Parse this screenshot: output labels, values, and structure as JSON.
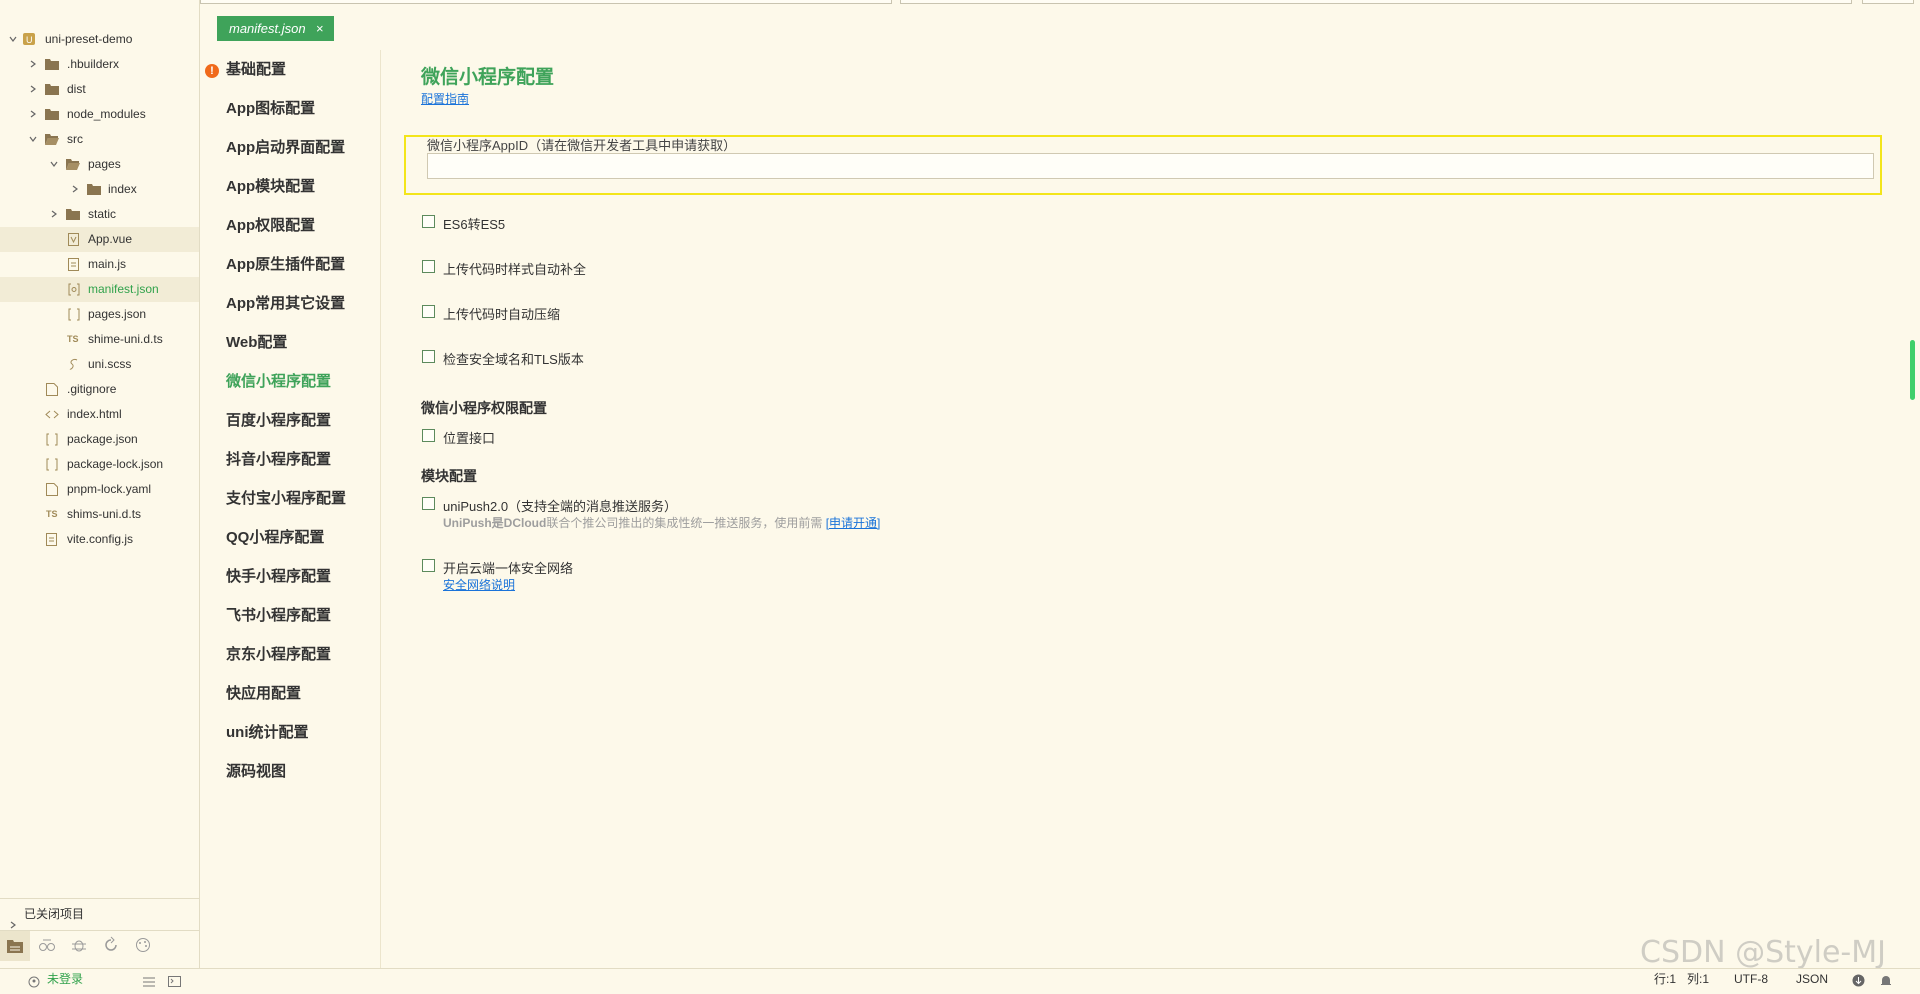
{
  "explorer": {
    "project": "uni-preset-demo",
    "items": [
      {
        "label": ".hbuilderx"
      },
      {
        "label": "dist"
      },
      {
        "label": "node_modules"
      },
      {
        "label": "src"
      },
      {
        "label": "pages"
      },
      {
        "label": "index"
      },
      {
        "label": "static"
      },
      {
        "label": "App.vue"
      },
      {
        "label": "main.js"
      },
      {
        "label": "manifest.json"
      },
      {
        "label": "pages.json"
      },
      {
        "label": "shime-uni.d.ts"
      },
      {
        "label": "uni.scss"
      },
      {
        "label": ".gitignore"
      },
      {
        "label": "index.html"
      },
      {
        "label": "package.json"
      },
      {
        "label": "package-lock.json"
      },
      {
        "label": "pnpm-lock.yaml"
      },
      {
        "label": "shims-uni.d.ts"
      },
      {
        "label": "vite.config.js"
      }
    ],
    "closed_projects": "已关闭项目"
  },
  "editor_tab": {
    "label": "manifest.json",
    "close": "×"
  },
  "nav": {
    "warning_glyph": "!",
    "items": [
      {
        "label": "基础配置"
      },
      {
        "label": "App图标配置"
      },
      {
        "label": "App启动界面配置"
      },
      {
        "label": "App模块配置"
      },
      {
        "label": "App权限配置"
      },
      {
        "label": "App原生插件配置"
      },
      {
        "label": "App常用其它设置"
      },
      {
        "label": "Web配置"
      },
      {
        "label": "微信小程序配置"
      },
      {
        "label": "百度小程序配置"
      },
      {
        "label": "抖音小程序配置"
      },
      {
        "label": "支付宝小程序配置"
      },
      {
        "label": "QQ小程序配置"
      },
      {
        "label": "快手小程序配置"
      },
      {
        "label": "飞书小程序配置"
      },
      {
        "label": "京东小程序配置"
      },
      {
        "label": "快应用配置"
      },
      {
        "label": "uni统计配置"
      },
      {
        "label": "源码视图"
      }
    ]
  },
  "content": {
    "title": "微信小程序配置",
    "guide_link": "配置指南",
    "appid_label": "微信小程序AppID（请在微信开发者工具中申请获取）",
    "appid_value": "",
    "options": [
      {
        "label": "ES6转ES5",
        "checked": false
      },
      {
        "label": "上传代码时样式自动补全",
        "checked": false
      },
      {
        "label": "上传代码时自动压缩",
        "checked": false
      },
      {
        "label": "检查安全域名和TLS版本",
        "checked": false
      }
    ],
    "permission_section": "微信小程序权限配置",
    "location_label": "位置接口",
    "module_section": "模块配置",
    "unipush_label": "uniPush2.0（支持全端的消息推送服务）",
    "unipush_desc_bold": "UniPush是DCloud",
    "unipush_desc": "联合个推公司推出的集成性统一推送服务，使用前需",
    "unipush_link": "[申请开通]",
    "cloud_label": "开启云端一体安全网络",
    "cloud_link": "安全网络说明"
  },
  "status_bar": {
    "login": "未登录",
    "row": "行:1",
    "col": "列:1",
    "encoding": "UTF-8",
    "lang": "JSON"
  },
  "watermark": "CSDN @Style-MJ",
  "colors": {
    "accent": "#3fa35a",
    "background": "#fdf9ea",
    "warning": "#f06a1b",
    "highlight": "#f3e51a",
    "link": "#1a73d9"
  }
}
